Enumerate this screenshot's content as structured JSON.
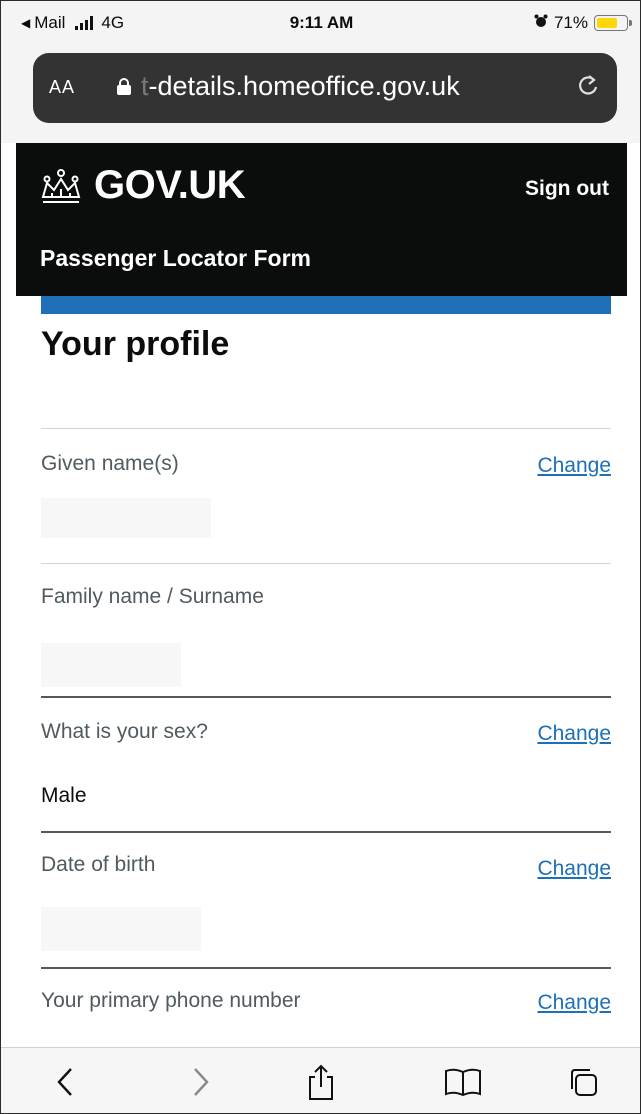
{
  "status_bar": {
    "back_app": "Mail",
    "network": "4G",
    "time": "9:11 AM",
    "battery": "71%",
    "battery_level": 0.71,
    "battery_color": "#ffd60a"
  },
  "browser": {
    "text_size_label": "AA",
    "url_faded": "t",
    "url": "-details.homeoffice.gov.uk",
    "reload_icon": "reload-icon"
  },
  "header": {
    "brand": "GOV.UK",
    "sign_out": "Sign out",
    "service_name": "Passenger Locator Form",
    "brand_bg": "#0b0c0c",
    "accent": "#1d70b8"
  },
  "main": {
    "title": "Your profile",
    "rows": [
      {
        "key": "Given name(s)",
        "value": "",
        "action": "Change"
      },
      {
        "key": "Family name / Surname",
        "value": "",
        "action": ""
      },
      {
        "key": "What is your sex?",
        "value": "Male",
        "action": "Change"
      },
      {
        "key": "Date of birth",
        "value": "",
        "action": "Change"
      },
      {
        "key": "Your primary phone number",
        "value": "",
        "action": "Change"
      }
    ]
  },
  "toolbar": {
    "icons": [
      "back-icon",
      "forward-icon",
      "share-icon",
      "bookmarks-icon",
      "tabs-icon"
    ]
  }
}
